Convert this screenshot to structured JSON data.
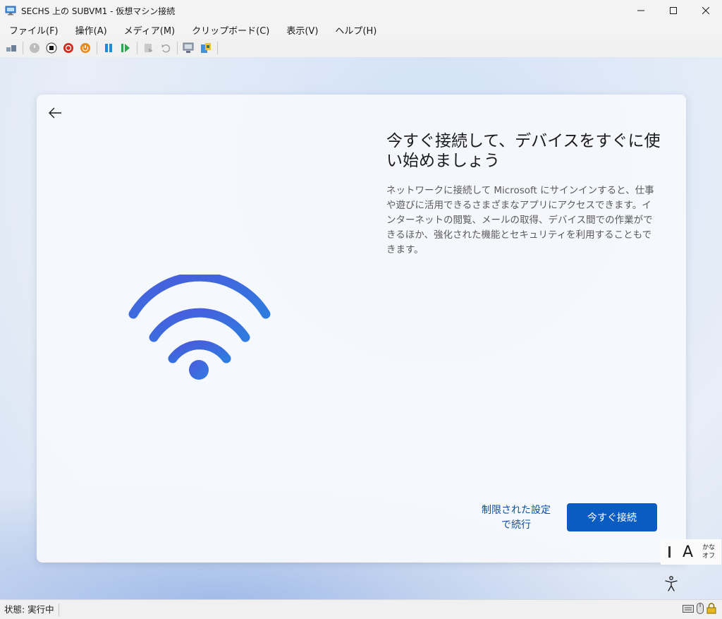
{
  "window": {
    "title": "SECHS 上の SUBVM1 - 仮想マシン接続"
  },
  "menu": {
    "items": [
      "ファイル(F)",
      "操作(A)",
      "メディア(M)",
      "クリップボード(C)",
      "表示(V)",
      "ヘルプ(H)"
    ]
  },
  "setup": {
    "heading": "今すぐ接続して、デバイスをすぐに使い始めましょう",
    "body": "ネットワークに接続して Microsoft にサインインすると、仕事や遊びに活用できるさまざまなアプリにアクセスできます。インターネットの閲覧、メールの取得、デバイス間での作業ができるほか、強化された機能とセキュリティを利用することもできます。",
    "limited_setup_line1": "制限された設定",
    "limited_setup_line2": "で続行",
    "connect_button": "今すぐ接続"
  },
  "ime": {
    "letter": "A",
    "mode_line1": "かな",
    "mode_line2": "オフ"
  },
  "status": {
    "text": "状態: 実行中"
  },
  "colors": {
    "accent": "#0a5cc2",
    "link": "#0a4fa3",
    "wifi_gradient": [
      "#3f63d8",
      "#2f78e0"
    ]
  }
}
